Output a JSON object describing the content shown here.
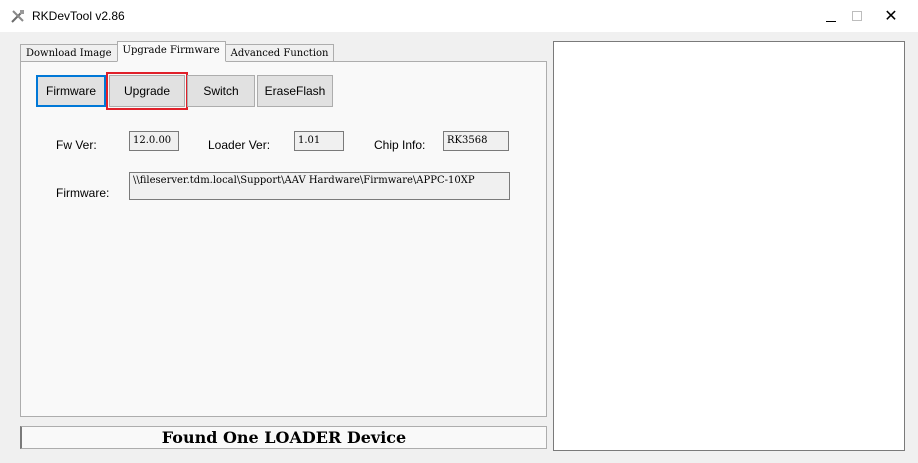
{
  "window": {
    "title": "RKDevTool v2.86",
    "minimize_icon": "minimize-icon",
    "maximize_icon": "maximize-icon",
    "close_icon": "close-icon",
    "close_glyph": "✕"
  },
  "tabs": [
    {
      "label": "Download Image",
      "active": false
    },
    {
      "label": "Upgrade Firmware",
      "active": true
    },
    {
      "label": "Advanced Function",
      "active": false
    }
  ],
  "toolbar": {
    "firmware_label": "Firmware",
    "upgrade_label": "Upgrade",
    "switch_label": "Switch",
    "eraseflash_label": "EraseFlash"
  },
  "info": {
    "fw_ver_label": "Fw Ver:",
    "fw_ver_value": "12.0.00",
    "loader_ver_label": "Loader Ver:",
    "loader_ver_value": "1.01",
    "chip_info_label": "Chip Info:",
    "chip_info_value": "RK3568",
    "firmware_label": "Firmware:",
    "firmware_path": "\\\\fileserver.tdm.local\\Support\\AAV Hardware\\Firmware\\APPC-10XP"
  },
  "status": {
    "text": "Found One LOADER Device"
  },
  "colors": {
    "selected_button_border": "#0078d7",
    "highlight_box": "#e0202a"
  }
}
